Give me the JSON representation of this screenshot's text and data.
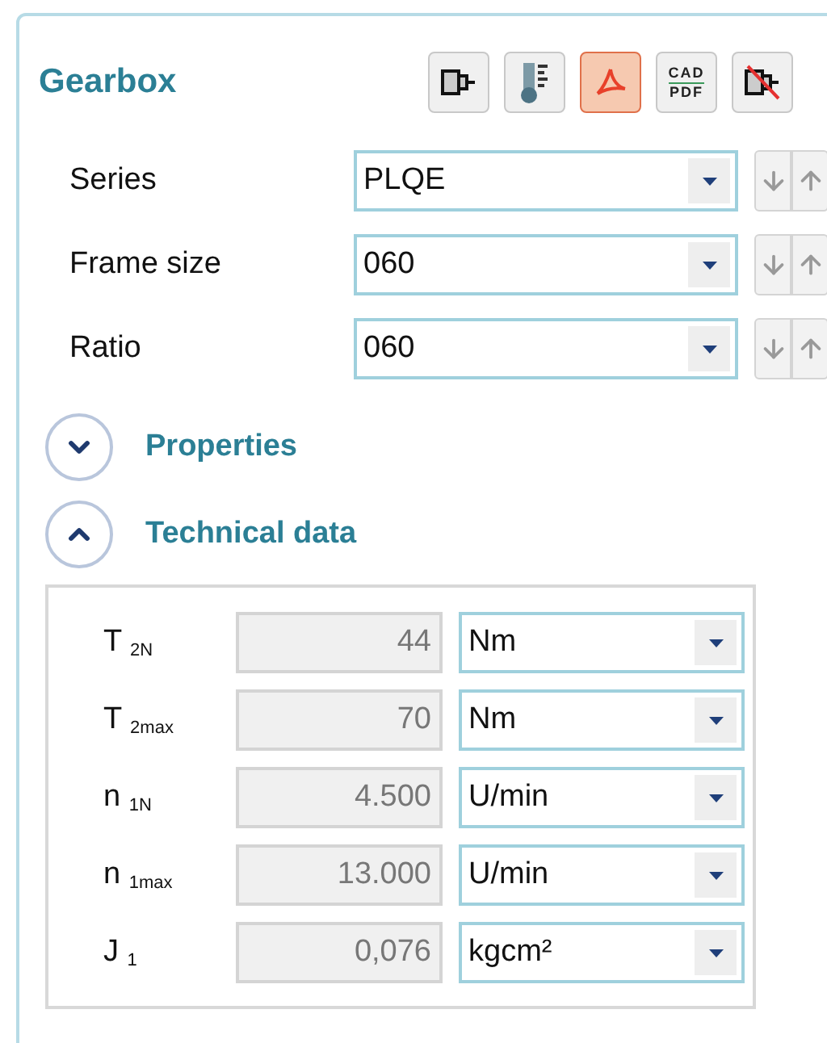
{
  "panel": {
    "title": "Gearbox"
  },
  "toolbar": [
    {
      "kind": "motor",
      "selected": false
    },
    {
      "kind": "thermometer",
      "selected": false
    },
    {
      "kind": "pdf",
      "selected": true
    },
    {
      "kind": "cad_pdf",
      "top": "CAD",
      "bottom": "PDF",
      "selected": false
    },
    {
      "kind": "no_motor",
      "selected": false
    }
  ],
  "fields": [
    {
      "label": "Series",
      "value": "PLQE"
    },
    {
      "label": "Frame size",
      "value": "060"
    },
    {
      "label": "Ratio",
      "value": "060"
    }
  ],
  "sections": [
    {
      "title": "Properties",
      "expanded": false
    },
    {
      "title": "Technical data",
      "expanded": true
    }
  ],
  "technical_data": [
    {
      "symbol": "T $_{2N}$",
      "value": "44",
      "unit": "Nm"
    },
    {
      "symbol": "T $_{2max}$",
      "value": "70",
      "unit": "Nm"
    },
    {
      "symbol": "n $_{1N}$",
      "value": "4.500",
      "unit": "U/min"
    },
    {
      "symbol": "n $_{1max}$",
      "value": "13.000",
      "unit": "U/min"
    },
    {
      "symbol": "J $_{1}$",
      "value": "0,076",
      "unit": "kgcm²"
    }
  ]
}
